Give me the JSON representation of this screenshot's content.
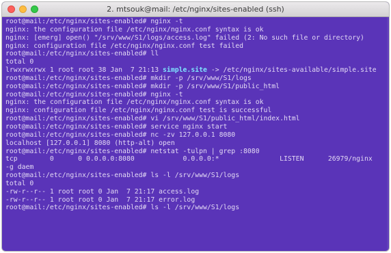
{
  "window": {
    "title": "2. mtsouk@mail: /etc/nginx/sites-enabled (ssh)"
  },
  "colors": {
    "terminal_background": "#5a34b8",
    "terminal_text": "#e2d8f4",
    "symlink_highlight": "#7fe4ff",
    "titlebar": "#e0dee0"
  },
  "terminal": {
    "lines": [
      {
        "text": "root@mail:/etc/nginx/sites-enabled# nginx -t"
      },
      {
        "text": "nginx: the configuration file /etc/nginx/nginx.conf syntax is ok"
      },
      {
        "text": "nginx: [emerg] open() \"/srv/www/S1/logs/access.log\" failed (2: No such file or directory)"
      },
      {
        "text": "nginx: configuration file /etc/nginx/nginx.conf test failed"
      },
      {
        "text": "root@mail:/etc/nginx/sites-enabled# ll"
      },
      {
        "text": "total 0"
      },
      {
        "pre": "lrwxrwxrwx 1 root root 38 Jan  7 21:13 ",
        "hl": "simple.site",
        "post": " -> /etc/nginx/sites-available/simple.site"
      },
      {
        "text": "root@mail:/etc/nginx/sites-enabled# mkdir -p /srv/www/S1/logs"
      },
      {
        "text": "root@mail:/etc/nginx/sites-enabled# mkdir -p /srv/www/S1/public_html"
      },
      {
        "text": "root@mail:/etc/nginx/sites-enabled# nginx -t"
      },
      {
        "text": "nginx: the configuration file /etc/nginx/nginx.conf syntax is ok"
      },
      {
        "text": "nginx: configuration file /etc/nginx/nginx.conf test is successful"
      },
      {
        "text": "root@mail:/etc/nginx/sites-enabled# vi /srv/www/S1/public_html/index.html"
      },
      {
        "text": "root@mail:/etc/nginx/sites-enabled# service nginx start"
      },
      {
        "text": "root@mail:/etc/nginx/sites-enabled# nc -zv 127.0.0.1 8080"
      },
      {
        "text": "localhost [127.0.0.1] 8080 (http-alt) open"
      },
      {
        "text": "root@mail:/etc/nginx/sites-enabled# netstat -tulpn | grep :8080"
      },
      {
        "text": "tcp        0      0 0.0.0.0:8080            0.0.0.0:*               LISTEN      26979/nginx"
      },
      {
        "text": "-g daem"
      },
      {
        "text": "root@mail:/etc/nginx/sites-enabled# ls -l /srv/www/S1/logs"
      },
      {
        "text": "total 0"
      },
      {
        "text": "-rw-r--r-- 1 root root 0 Jan  7 21:17 access.log"
      },
      {
        "text": "-rw-r--r-- 1 root root 0 Jan  7 21:17 error.log"
      },
      {
        "text": "root@mail:/etc/nginx/sites-enabled# ls -l /srv/www/S1/logs"
      }
    ]
  }
}
